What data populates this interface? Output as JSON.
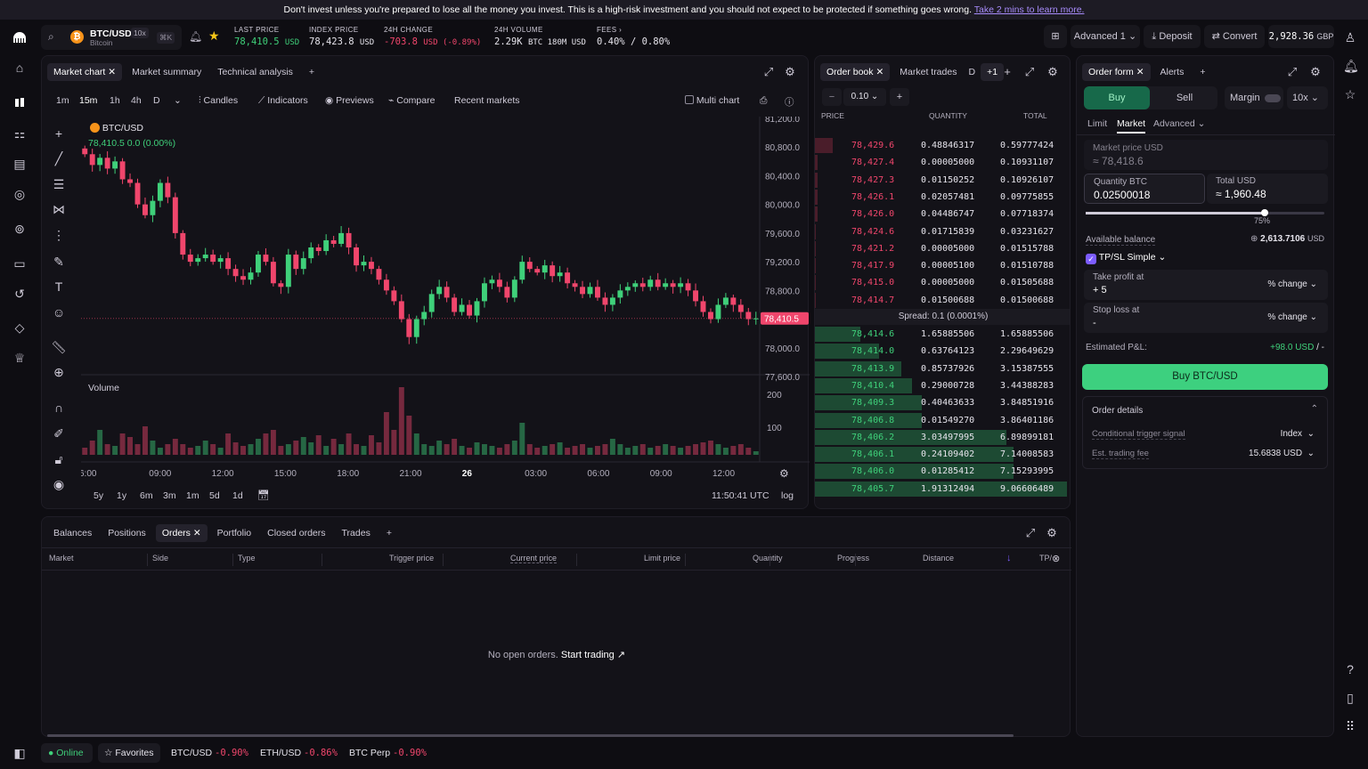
{
  "banner": {
    "text": "Don't invest unless you're prepared to lose all the money you invest. This is a high-risk investment and you should not expect to be protected if something goes wrong.",
    "link": "Take 2 mins to learn more."
  },
  "pair": {
    "symbol": "BTC/USD",
    "leverage": "10x",
    "name": "Bitcoin",
    "shortcut": "⌘K"
  },
  "stats": [
    {
      "label": "LAST PRICE",
      "value": "78,410.5",
      "unit": "USD"
    },
    {
      "label": "INDEX PRICE",
      "value": "78,423.8",
      "unit": "USD"
    },
    {
      "label": "24H CHANGE",
      "value": "-703.8",
      "unit": "USD (-0.89%)"
    },
    {
      "label": "24H VOLUME",
      "value": "2.29K",
      "unit": "BTC  180M USD"
    },
    {
      "label": "FEES",
      "value": "0.40%",
      "unit": "/ 0.80%"
    }
  ],
  "top_actions": {
    "mode": "Advanced 1",
    "deposit": "Deposit",
    "convert": "Convert",
    "balance": "2,928.36",
    "balance_ccy": "GBP"
  },
  "chart_panel": {
    "tabs": [
      "Market chart",
      "Market summary",
      "Technical analysis"
    ],
    "timeframes": [
      "1m",
      "15m",
      "1h",
      "4h",
      "D"
    ],
    "controls": [
      "Candles",
      "Indicators",
      "Previews",
      "Compare",
      "Recent markets",
      "Multi chart"
    ],
    "legend_symbol": "BTC/USD",
    "legend_values": "78,410.5  0.0 (0.00%)",
    "volume_label": "Volume",
    "price_ticks": [
      "81,200.0",
      "80,800.0",
      "80,400.0",
      "80,000.0",
      "79,600.0",
      "79,200.0",
      "78,800.0",
      "78,400.0",
      "78,000.0",
      "77,600.0"
    ],
    "last_price_tag": "78,410.5",
    "volume_ticks": [
      "200",
      "100"
    ],
    "time_ticks": [
      "6:00",
      "09:00",
      "12:00",
      "15:00",
      "18:00",
      "21:00",
      "26",
      "03:00",
      "06:00",
      "09:00",
      "12:00"
    ],
    "ranges": [
      "5y",
      "1y",
      "6m",
      "3m",
      "1m",
      "5d",
      "1d"
    ],
    "clock": "11:50:41 UTC",
    "scale": "log"
  },
  "chart_data": {
    "type": "candlestick",
    "title": "BTC/USD",
    "interval": "15m",
    "ylim": [
      77600,
      81200
    ],
    "last": 78410.5,
    "closes": [
      80700,
      80550,
      80650,
      80500,
      80600,
      80350,
      80300,
      80000,
      79850,
      80050,
      80300,
      80100,
      79600,
      79300,
      79200,
      79250,
      79300,
      79200,
      79250,
      79100,
      79000,
      78950,
      79050,
      79300,
      79200,
      78900,
      78850,
      79300,
      79100,
      79250,
      79400,
      79350,
      79500,
      79450,
      79600,
      79400,
      79150,
      79200,
      79100,
      78950,
      78800,
      78650,
      78400,
      78150,
      78400,
      78500,
      78750,
      78850,
      78700,
      78500,
      78600,
      78450,
      78650,
      78900,
      78950,
      78850,
      78700,
      78950,
      79200,
      79100,
      79050,
      79150,
      79000,
      79050,
      78900,
      78850,
      78750,
      78850,
      78700,
      78600,
      78700,
      78800,
      78850,
      78900,
      78850,
      78950,
      78850,
      78900,
      78850,
      78900,
      78800,
      78650,
      78500,
      78400,
      78600,
      78700,
      78600,
      78500,
      78400,
      78410
    ],
    "volumes": [
      20,
      40,
      70,
      30,
      25,
      60,
      50,
      30,
      80,
      40,
      20,
      30,
      45,
      30,
      20,
      25,
      40,
      30,
      20,
      60,
      35,
      25,
      30,
      45,
      60,
      70,
      25,
      30,
      40,
      50,
      35,
      55,
      25,
      45,
      30,
      60,
      30,
      25,
      55,
      35,
      120,
      70,
      190,
      110,
      60,
      30,
      25,
      40,
      30,
      45,
      25,
      20,
      35,
      30,
      25,
      20,
      30,
      40,
      90,
      30,
      20,
      25,
      30,
      35,
      20,
      25,
      30,
      20,
      25,
      30,
      45,
      30,
      20,
      25,
      30,
      20,
      25,
      30,
      25,
      20,
      25,
      30,
      35,
      40,
      30,
      20,
      25,
      30,
      20,
      10
    ]
  },
  "orderbook": {
    "tabs": [
      "Order book",
      "Market trades",
      "D"
    ],
    "more": "+1",
    "tick": "0.10",
    "columns": [
      "PRICE",
      "QUANTITY",
      "TOTAL"
    ],
    "asks": [
      {
        "price": "78,429.6",
        "qty": "0.48846317",
        "total": "0.59777424",
        "depth": 0.07
      },
      {
        "price": "78,427.4",
        "qty": "0.00005000",
        "total": "0.10931107",
        "depth": 0.012
      },
      {
        "price": "78,427.3",
        "qty": "0.01150252",
        "total": "0.10926107",
        "depth": 0.012
      },
      {
        "price": "78,426.1",
        "qty": "0.02057481",
        "total": "0.09775855",
        "depth": 0.011
      },
      {
        "price": "78,426.0",
        "qty": "0.04486747",
        "total": "0.07718374",
        "depth": 0.009
      },
      {
        "price": "78,424.6",
        "qty": "0.01715839",
        "total": "0.03231627",
        "depth": 0.004
      },
      {
        "price": "78,421.2",
        "qty": "0.00005000",
        "total": "0.01515788",
        "depth": 0.002
      },
      {
        "price": "78,417.9",
        "qty": "0.00005100",
        "total": "0.01510788",
        "depth": 0.002
      },
      {
        "price": "78,415.0",
        "qty": "0.00005000",
        "total": "0.01505688",
        "depth": 0.002
      },
      {
        "price": "78,414.7",
        "qty": "0.01500688",
        "total": "0.01500688",
        "depth": 0.002
      }
    ],
    "spread": "Spread: 0.1 (0.0001%)",
    "bids": [
      {
        "price": "78,414.6",
        "qty": "1.65885506",
        "total": "1.65885506",
        "depth": 0.18
      },
      {
        "price": "78,414.0",
        "qty": "0.63764123",
        "total": "2.29649629",
        "depth": 0.25
      },
      {
        "price": "78,413.9",
        "qty": "0.85737926",
        "total": "3.15387555",
        "depth": 0.34
      },
      {
        "price": "78,410.4",
        "qty": "0.29000728",
        "total": "3.44388283",
        "depth": 0.38
      },
      {
        "price": "78,409.3",
        "qty": "0.40463633",
        "total": "3.84851916",
        "depth": 0.42
      },
      {
        "price": "78,406.8",
        "qty": "0.01549270",
        "total": "3.86401186",
        "depth": 0.42
      },
      {
        "price": "78,406.2",
        "qty": "3.03497995",
        "total": "6.89899181",
        "depth": 0.75
      },
      {
        "price": "78,406.1",
        "qty": "0.24109402",
        "total": "7.14008583",
        "depth": 0.78
      },
      {
        "price": "78,406.0",
        "qty": "0.01285412",
        "total": "7.15293995",
        "depth": 0.78
      },
      {
        "price": "78,405.7",
        "qty": "1.91312494",
        "total": "9.06606489",
        "depth": 0.99
      }
    ]
  },
  "orderform": {
    "tabs": [
      "Order form",
      "Alerts"
    ],
    "buy": "Buy",
    "sell": "Sell",
    "margin": "Margin",
    "leverage": "10x",
    "types": [
      "Limit",
      "Market",
      "Advanced"
    ],
    "market_price_label": "Market price USD",
    "market_price": "≈  78,418.6",
    "qty_label": "Quantity BTC",
    "qty": "0.02500018",
    "total_label": "Total USD",
    "total": "≈  1,960.48",
    "slider_value": 0.75,
    "slider_text": "75%",
    "avail_label": "Available balance",
    "avail": "2,613.7106",
    "avail_ccy": "USD",
    "tpsl": "TP/SL Simple",
    "tp_label": "Take profit at",
    "tp_value": "+  5",
    "tp_mode": "% change",
    "sl_label": "Stop loss at",
    "sl_value": "-",
    "sl_mode": "% change",
    "pnl_label": "Estimated P&L:",
    "pnl_value": "+98.0 USD",
    "pnl_rest": "/ -",
    "submit": "Buy BTC/USD",
    "details_title": "Order details",
    "trigger_label": "Conditional trigger signal",
    "trigger_value": "Index",
    "fee_label": "Est. trading fee",
    "fee_value": "15.6838 USD"
  },
  "orders_panel": {
    "tabs": [
      "Balances",
      "Positions",
      "Orders",
      "Portfolio",
      "Closed orders",
      "Trades"
    ],
    "columns": [
      "Market",
      "Side",
      "Type",
      "Trigger price",
      "Current price",
      "Limit price",
      "Quantity",
      "Progress",
      "Distance",
      "TP/"
    ],
    "empty_text": "No open orders.",
    "empty_link": "Start trading"
  },
  "bottombar": {
    "status": "Online",
    "favorites": "Favorites",
    "tickers": [
      {
        "sym": "BTC/USD",
        "chg": "-0.90%"
      },
      {
        "sym": "ETH/USD",
        "chg": "-0.86%"
      },
      {
        "sym": "BTC Perp",
        "chg": "-0.90%"
      }
    ]
  }
}
